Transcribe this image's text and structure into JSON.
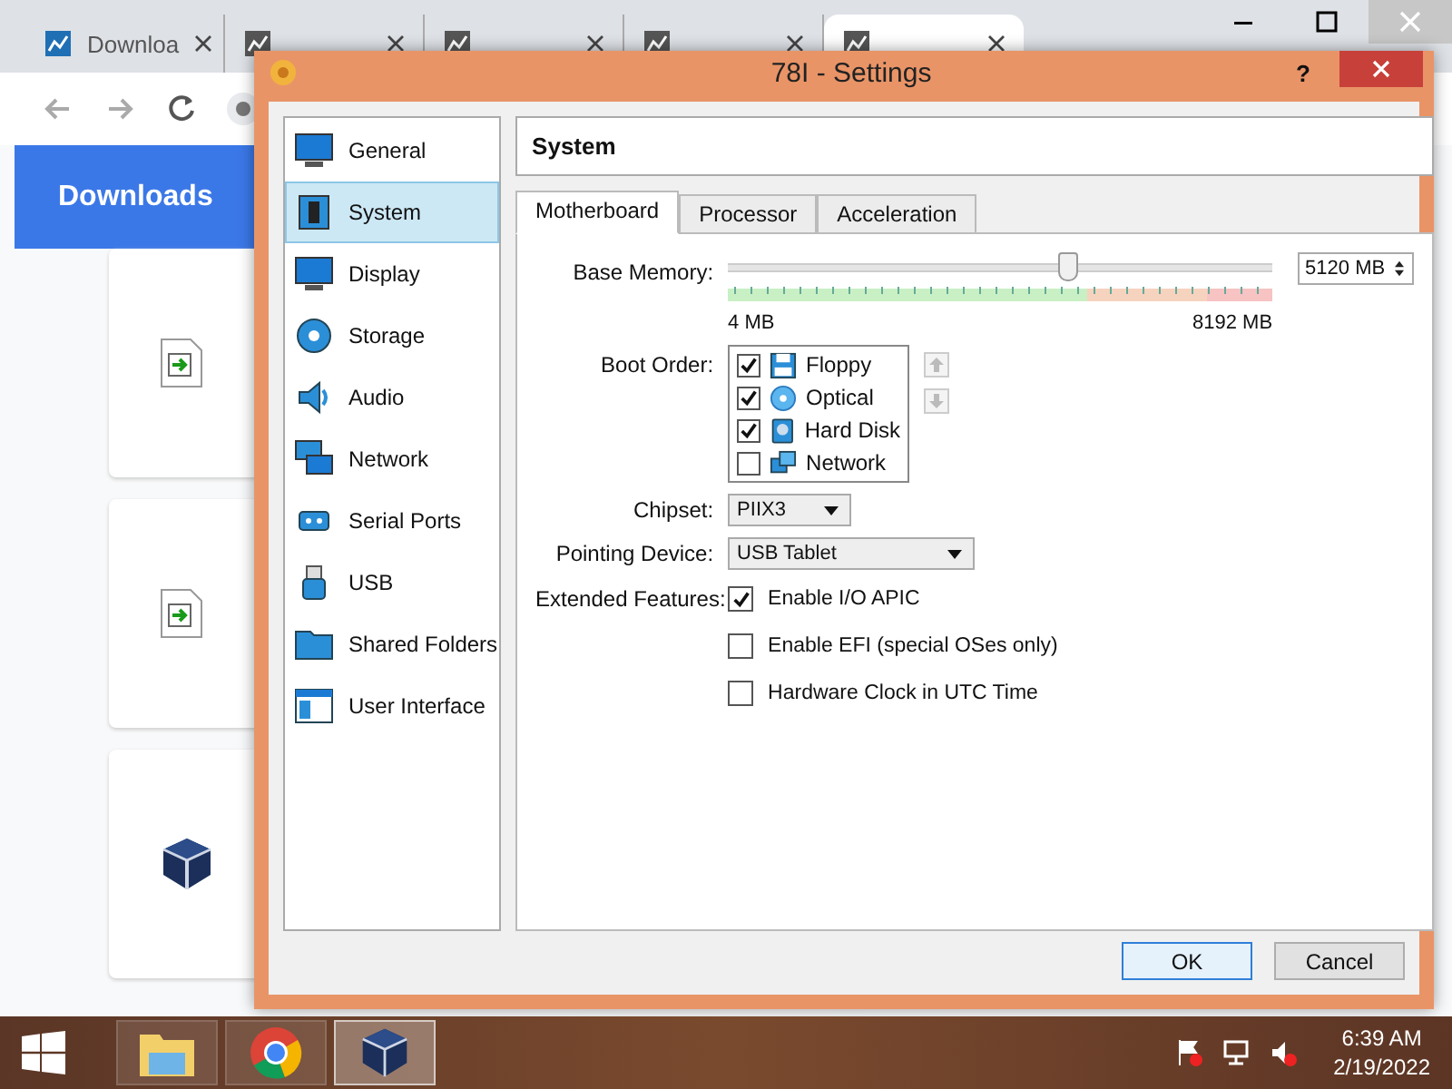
{
  "browser": {
    "tabs": [
      {
        "title": "Downloa",
        "selected": false
      },
      {
        "selected": false
      },
      {
        "selected": false
      },
      {
        "selected": false
      },
      {
        "selected": true
      }
    ],
    "header": "Downloads"
  },
  "dialog": {
    "title": "78I - Settings",
    "help": "?",
    "sidebar": [
      {
        "label": "General",
        "selected": false
      },
      {
        "label": "System",
        "selected": true
      },
      {
        "label": "Display",
        "selected": false
      },
      {
        "label": "Storage",
        "selected": false
      },
      {
        "label": "Audio",
        "selected": false
      },
      {
        "label": "Network",
        "selected": false
      },
      {
        "label": "Serial Ports",
        "selected": false
      },
      {
        "label": "USB",
        "selected": false
      },
      {
        "label": "Shared Folders",
        "selected": false
      },
      {
        "label": "User Interface",
        "selected": false
      }
    ],
    "section_title": "System",
    "tabs": [
      {
        "label": "Motherboard",
        "selected": true
      },
      {
        "label": "Processor",
        "selected": false
      },
      {
        "label": "Acceleration",
        "selected": false
      }
    ],
    "base_memory": {
      "label": "Base Memory:",
      "level": 0.625,
      "value": "5120 MB",
      "min_label": "4 MB",
      "max_label": "8192 MB"
    },
    "boot_order": {
      "label": "Boot Order:",
      "items": [
        {
          "label": "Floppy",
          "checked": true
        },
        {
          "label": "Optical",
          "checked": true
        },
        {
          "label": "Hard Disk",
          "checked": true
        },
        {
          "label": "Network",
          "checked": false
        }
      ]
    },
    "chipset": {
      "label": "Chipset:",
      "value": "PIIX3"
    },
    "pointing_device": {
      "label": "Pointing Device:",
      "value": "USB Tablet"
    },
    "extended_features": {
      "label": "Extended Features:",
      "options": [
        {
          "label": "Enable I/O APIC",
          "checked": true
        },
        {
          "label": "Enable EFI (special OSes only)",
          "checked": false
        },
        {
          "label": "Hardware Clock in UTC Time",
          "checked": false
        }
      ]
    },
    "buttons": [
      "OK",
      "Cancel"
    ]
  },
  "taskbar": {
    "apps": [
      {
        "selected": false
      },
      {
        "selected": false
      },
      {
        "selected": true
      }
    ],
    "time": "6:39 AM",
    "date": "2/19/2022"
  }
}
